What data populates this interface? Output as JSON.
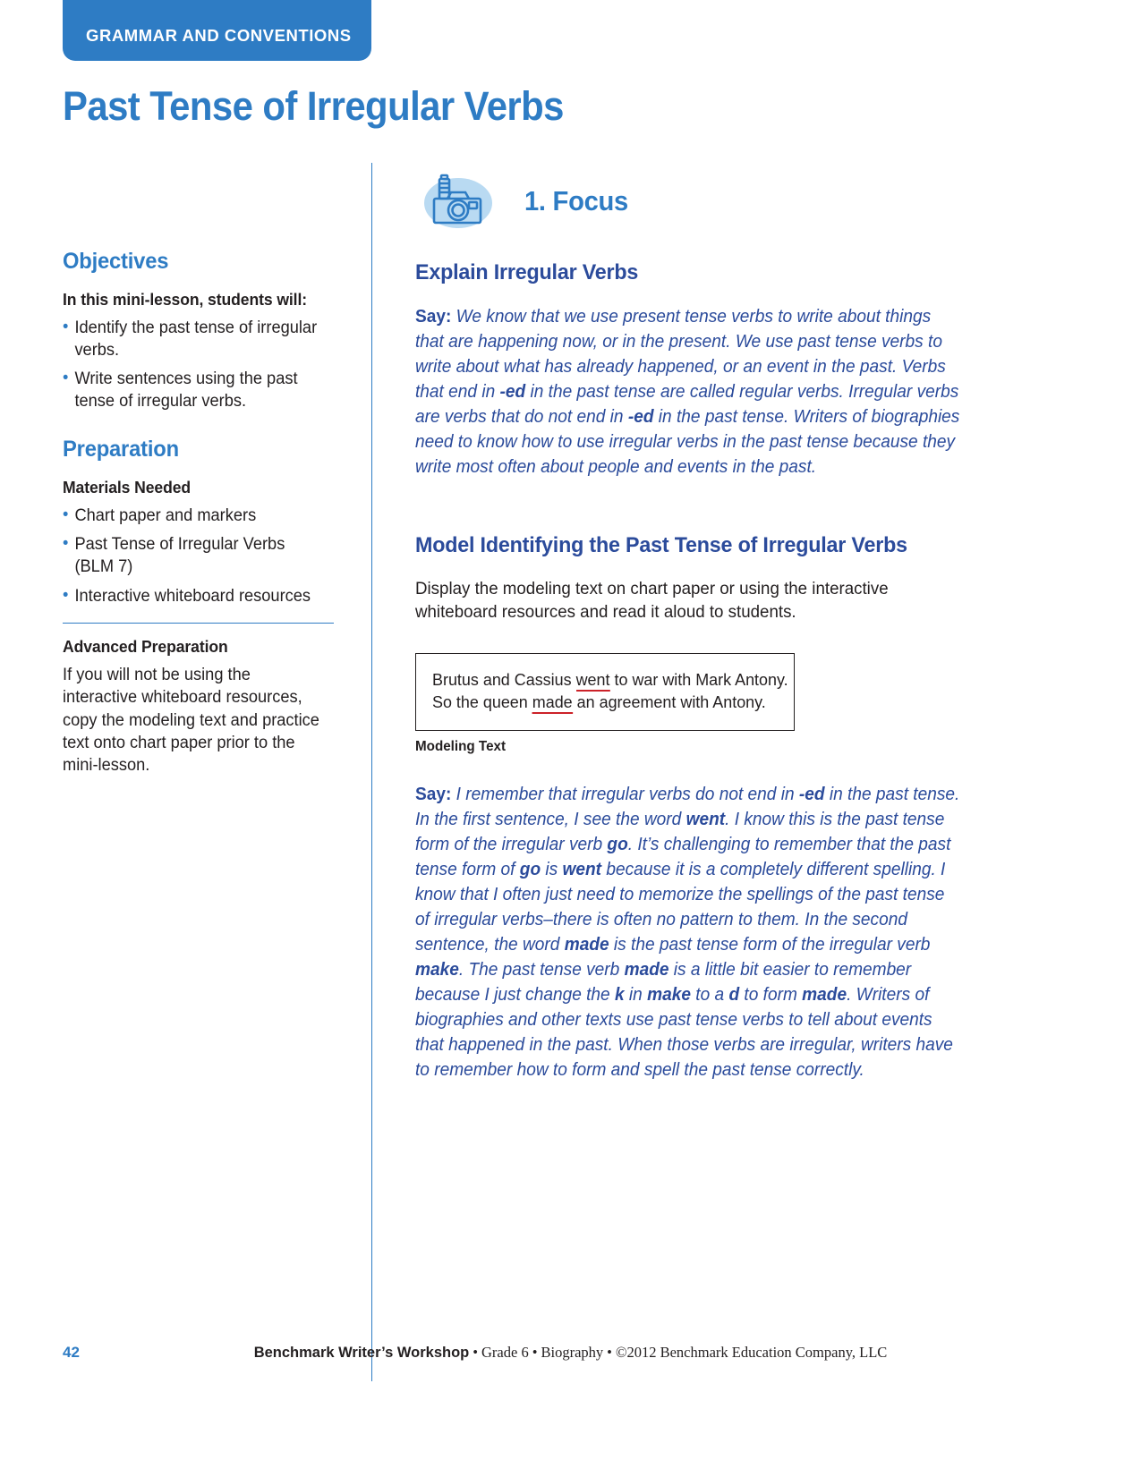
{
  "header": {
    "strand_tab": "GRAMMAR AND CONVENTIONS",
    "title": "Past Tense of Irregular Verbs"
  },
  "colors": {
    "brand_blue": "#2e7cc4",
    "deep_blue": "#2b4b9b",
    "icon_bg_blue": "#b9daf2",
    "underline_red": "#cc2229",
    "text_black": "#231f20"
  },
  "sidebar": {
    "objectives": {
      "heading": "Objectives",
      "lead": "In this mini-lesson, students will:",
      "items": [
        "Identify the past tense of irregular verbs.",
        "Write sentences using the past tense of irregular verbs."
      ]
    },
    "preparation": {
      "heading": "Preparation",
      "materials_heading": "Materials Needed",
      "materials": [
        "Chart paper and markers",
        "Past Tense of Irregular Verbs (BLM 7)",
        "Interactive whiteboard resources"
      ],
      "advanced_heading": "Advanced Preparation",
      "advanced_body": "If you will not be using the interactive whiteboard resources, copy the modeling text and practice text onto chart paper prior to the mini-lesson."
    }
  },
  "main": {
    "section": {
      "icon": "camera-icon",
      "number_and_title": "1. Focus"
    },
    "explain": {
      "heading": "Explain Irregular Verbs",
      "say_label": "Say:",
      "say_parts": [
        {
          "text": " We know that we use present tense verbs to write about things that are happening now, or in the present. We use past tense verbs to write about what has already happened, or an event in the past. Verbs that end in ",
          "bold": false
        },
        {
          "text": "-ed",
          "bold": true
        },
        {
          "text": " in the past tense are called regular verbs. Irregular verbs are verbs that do not end in ",
          "bold": false
        },
        {
          "text": "-ed",
          "bold": true
        },
        {
          "text": " in the past tense. Writers of biographies need to know how to use irregular verbs in the past tense because they write most often about people and events in the past.",
          "bold": false
        }
      ]
    },
    "model": {
      "heading": "Model Identifying the Past Tense of Irregular Verbs",
      "instruction": "Display the modeling text on chart paper or using the interactive whiteboard resources and read it aloud to students.",
      "box_caption": "Modeling Text",
      "box_lines": [
        [
          {
            "text": "Brutus and Cassius ",
            "underline": false
          },
          {
            "text": "went",
            "underline": true
          },
          {
            "text": " to war with Mark Antony.",
            "underline": false
          }
        ],
        [
          {
            "text": "So the queen ",
            "underline": false
          },
          {
            "text": "made",
            "underline": true
          },
          {
            "text": " an agreement with Antony.",
            "underline": false
          }
        ]
      ],
      "say_label": "Say:",
      "say_parts": [
        {
          "text": " I remember that irregular verbs do not end in ",
          "bold": false
        },
        {
          "text": "-ed",
          "bold": true
        },
        {
          "text": " in the past tense. In the first sentence, I see the word ",
          "bold": false
        },
        {
          "text": "went",
          "bold": true
        },
        {
          "text": ". I know this is the past tense form of the irregular verb ",
          "bold": false
        },
        {
          "text": "go",
          "bold": true
        },
        {
          "text": ". It’s challenging to remember that the past tense form of ",
          "bold": false
        },
        {
          "text": "go",
          "bold": true
        },
        {
          "text": " is ",
          "bold": false
        },
        {
          "text": "went",
          "bold": true
        },
        {
          "text": " because it is a completely different spelling. I know that I often just need to memorize the spellings of the past tense of irregular verbs–there is often no pattern to them. In the second sentence, the word ",
          "bold": false
        },
        {
          "text": "made",
          "bold": true
        },
        {
          "text": " is the past tense form of the irregular verb ",
          "bold": false
        },
        {
          "text": "make",
          "bold": true
        },
        {
          "text": ". The past tense verb ",
          "bold": false
        },
        {
          "text": "made",
          "bold": true
        },
        {
          "text": " is a little bit easier to remember because I just change the ",
          "bold": false
        },
        {
          "text": "k",
          "bold": true
        },
        {
          "text": " in ",
          "bold": false
        },
        {
          "text": "make",
          "bold": true
        },
        {
          "text": " to a ",
          "bold": false
        },
        {
          "text": "d",
          "bold": true
        },
        {
          "text": " to form ",
          "bold": false
        },
        {
          "text": "made",
          "bold": true
        },
        {
          "text": ". Writers of biographies and other texts use past tense verbs to tell about events that happened in the past. When those verbs are irregular, writers have to remember how to form and spell the past tense correctly.",
          "bold": false
        }
      ]
    }
  },
  "footer": {
    "page_number": "42",
    "brand": "Benchmark Writer’s Workshop",
    "grade": "Grade 6",
    "unit": "Biography",
    "copyright": "©2012 Benchmark Education Company, LLC",
    "separator": "•"
  }
}
